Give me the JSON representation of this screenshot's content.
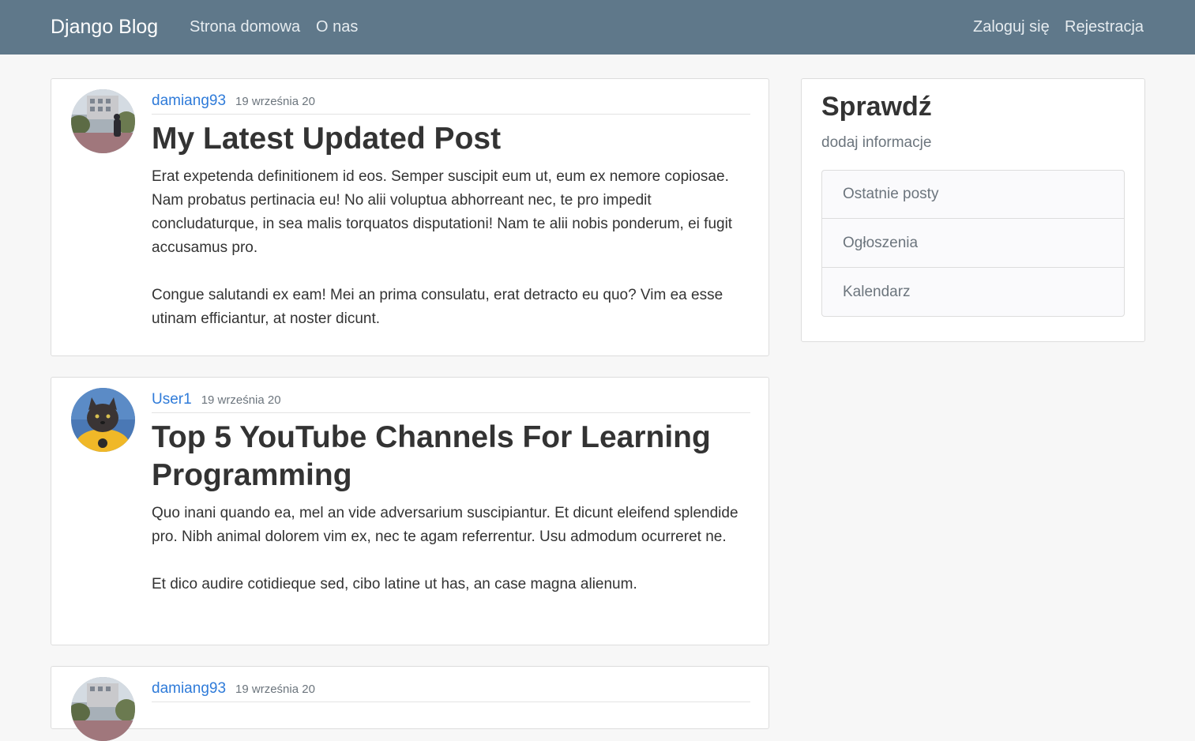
{
  "navbar": {
    "brand": "Django Blog",
    "links": [
      "Strona domowa",
      "O nas"
    ],
    "auth_links": [
      "Zaloguj się",
      "Rejestracja"
    ]
  },
  "posts": [
    {
      "author": "damiang93",
      "date": "19 września 20",
      "title": "My Latest Updated Post",
      "paragraphs": [
        "Erat expetenda definitionem id eos. Semper suscipit eum ut, eum ex nemore copiosae. Nam probatus pertinacia eu! No alii voluptua abhorreant nec, te pro impedit concludaturque, in sea malis torquatos disputationi! Nam te alii nobis ponderum, ei fugit accusamus pro.",
        "Congue salutandi ex eam! Mei an prima consulatu, erat detracto eu quo? Vim ea esse utinam efficiantur, at noster dicunt."
      ]
    },
    {
      "author": "User1",
      "date": "19 września 20",
      "title": "Top 5 YouTube Channels For Learning Programming",
      "paragraphs": [
        "Quo inani quando ea, mel an vide adversarium suscipiantur. Et dicunt eleifend splendide pro. Nibh animal dolorem vim ex, nec te agam referrentur. Usu admodum ocurreret ne.",
        "Et dico audire cotidieque sed, cibo latine ut has, an case magna alienum."
      ]
    },
    {
      "author": "damiang93",
      "date": "19 września 20"
    }
  ],
  "sidebar": {
    "title": "Sprawdź",
    "subtitle": "dodaj informacje",
    "items": [
      "Ostatnie posty",
      "Ogłoszenia",
      "Kalendarz"
    ]
  },
  "colors": {
    "navbar": "#5f788a",
    "link": "#2f7bd9"
  }
}
